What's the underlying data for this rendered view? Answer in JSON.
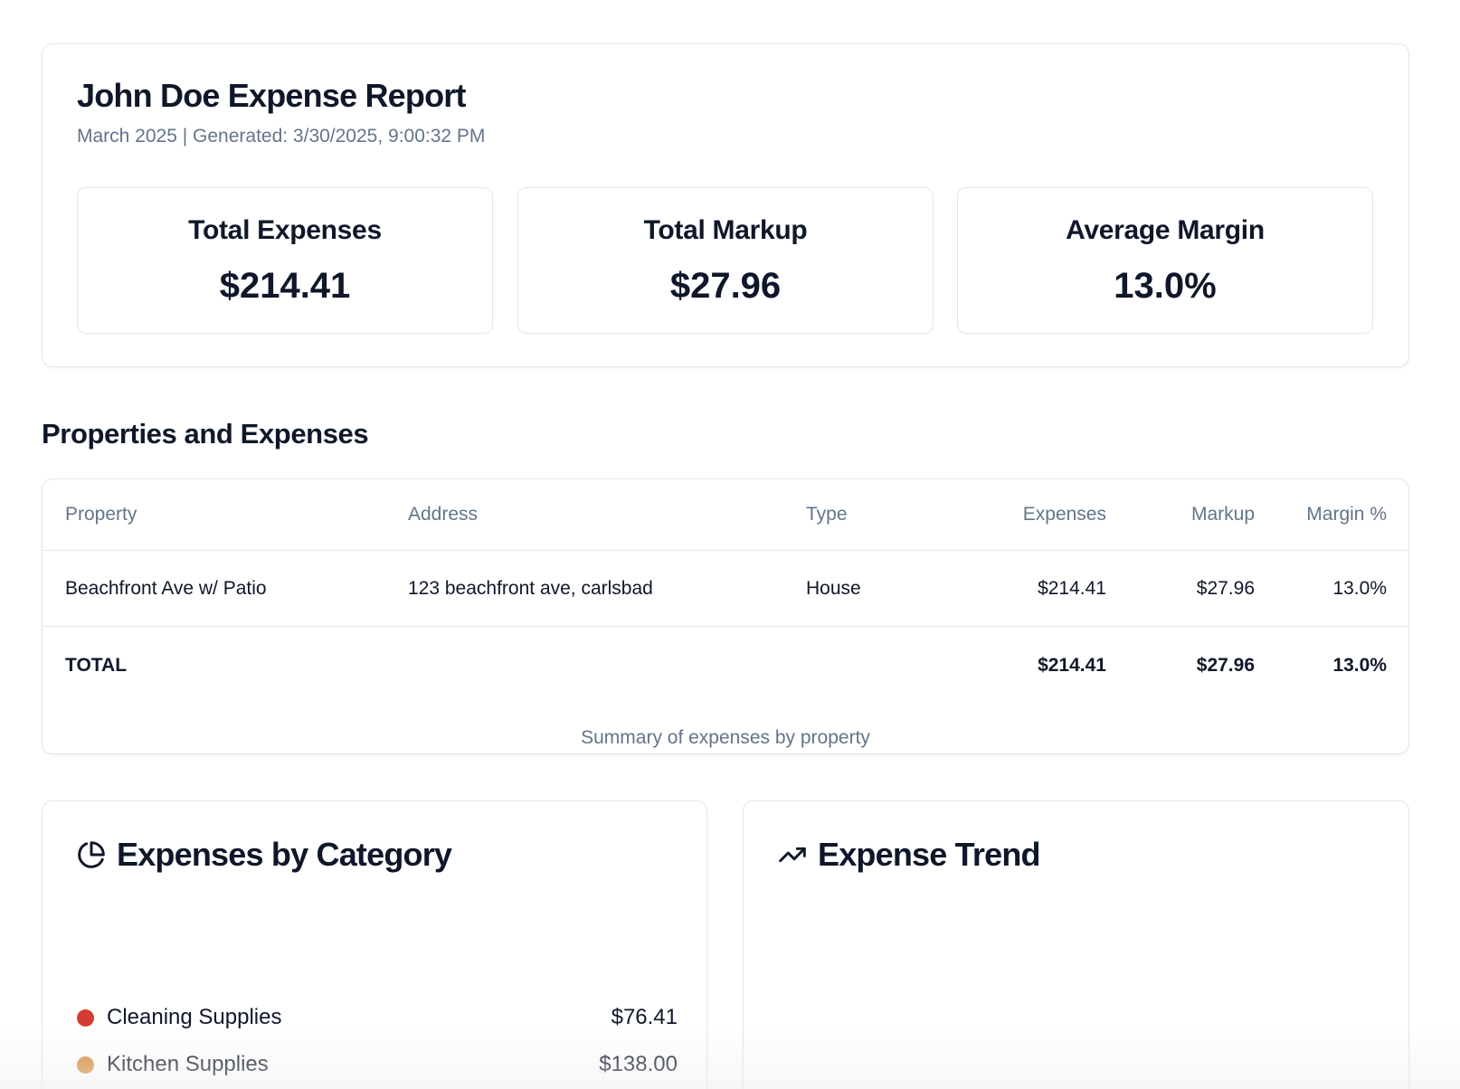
{
  "report": {
    "title": "John Doe Expense Report",
    "subtitle": "March 2025 | Generated: 3/30/2025, 9:00:32 PM"
  },
  "stats": [
    {
      "label": "Total Expenses",
      "value": "$214.41"
    },
    {
      "label": "Total Markup",
      "value": "$27.96"
    },
    {
      "label": "Average Margin",
      "value": "13.0%"
    }
  ],
  "properties_section": {
    "title": "Properties and Expenses",
    "columns": [
      "Property",
      "Address",
      "Type",
      "Expenses",
      "Markup",
      "Margin %"
    ],
    "rows": [
      {
        "property": "Beachfront Ave w/ Patio",
        "address": "123 beachfront ave, carlsbad",
        "type": "House",
        "expenses": "$214.41",
        "markup": "$27.96",
        "margin": "13.0%"
      }
    ],
    "total": {
      "label": "TOTAL",
      "expenses": "$214.41",
      "markup": "$27.96",
      "margin": "13.0%"
    },
    "caption": "Summary of expenses by property"
  },
  "category_card": {
    "title": "Expenses by Category",
    "icon": "pie-chart-icon",
    "items": [
      {
        "label": "Cleaning Supplies",
        "value": "$76.41",
        "color": "#d43c33"
      },
      {
        "label": "Kitchen Supplies",
        "value": "$138.00",
        "color": "#d98a3a"
      }
    ]
  },
  "trend_card": {
    "title": "Expense Trend",
    "icon": "trending-up-icon"
  }
}
